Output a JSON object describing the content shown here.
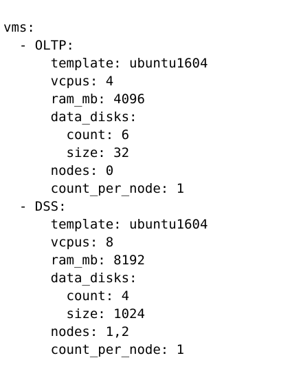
{
  "code": {
    "lines": [
      "vms:",
      "  - OLTP:",
      "      template: ubuntu1604",
      "      vcpus: 4",
      "      ram_mb: 4096",
      "      data_disks:",
      "        count: 6",
      "        size: 32",
      "      nodes: 0",
      "      count_per_node: 1",
      "  - DSS:",
      "      template: ubuntu1604",
      "      vcpus: 8",
      "      ram_mb: 8192",
      "      data_disks:",
      "        count: 4",
      "        size: 1024",
      "      nodes: 1,2",
      "      count_per_node: 1"
    ]
  }
}
